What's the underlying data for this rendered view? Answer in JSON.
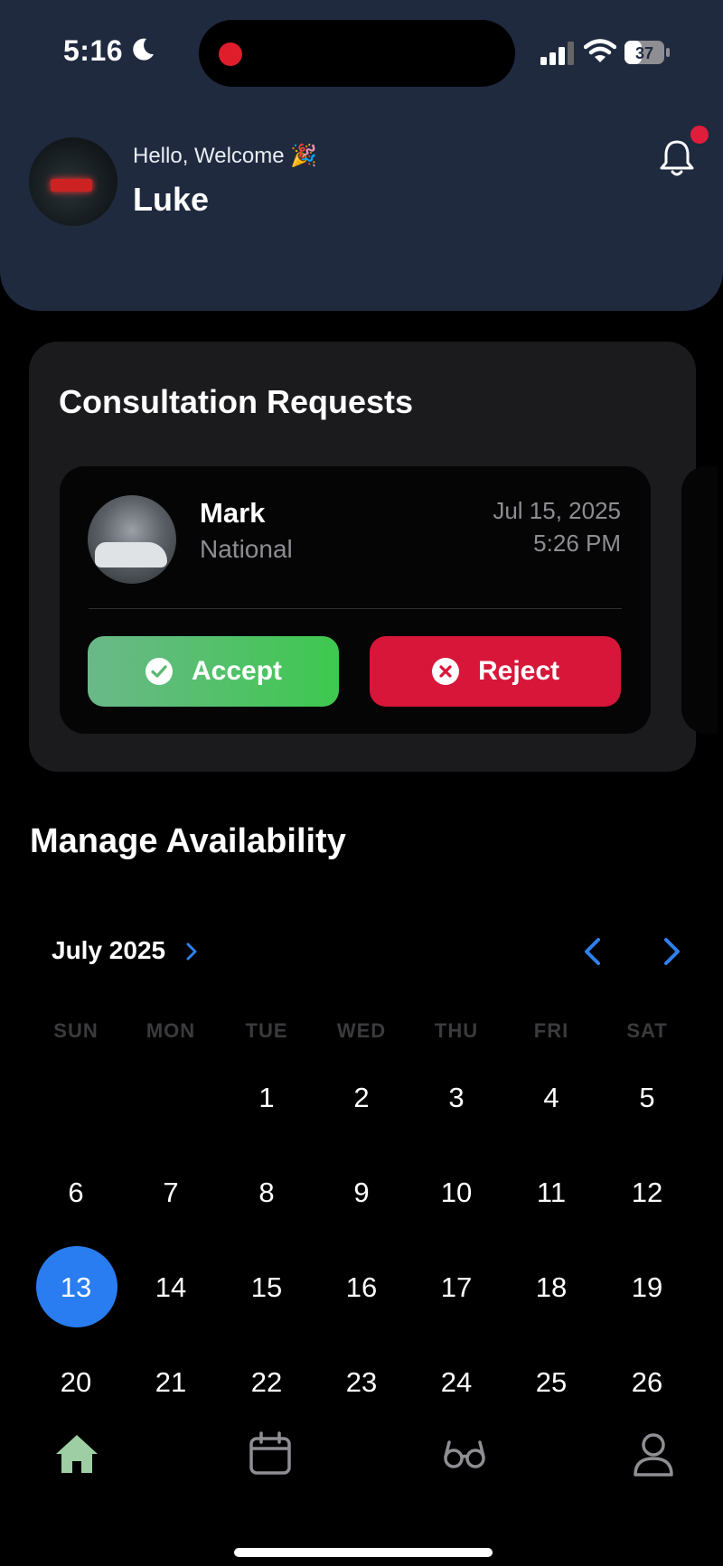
{
  "status_bar": {
    "time": "5:16",
    "battery": "37",
    "icons": [
      "moon-icon",
      "recording-dot",
      "signal-icon",
      "wifi-icon",
      "battery-icon"
    ]
  },
  "header": {
    "greeting": "Hello, Welcome 🎉",
    "user_name": "Luke",
    "notification_icon": "bell-icon",
    "has_unread": true
  },
  "consultation": {
    "title": "Consultation Requests",
    "request": {
      "name": "Mark",
      "subtitle": "National",
      "date": "Jul 15, 2025",
      "time": "5:26 PM",
      "accept_label": "Accept",
      "reject_label": "Reject"
    }
  },
  "availability": {
    "title": "Manage Availability",
    "month_label": "July 2025",
    "weekdays": [
      "SUN",
      "MON",
      "TUE",
      "WED",
      "THU",
      "FRI",
      "SAT"
    ],
    "days": [
      [
        "",
        "",
        "1",
        "2",
        "3",
        "4",
        "5"
      ],
      [
        "6",
        "7",
        "8",
        "9",
        "10",
        "11",
        "12"
      ],
      [
        "13",
        "14",
        "15",
        "16",
        "17",
        "18",
        "19"
      ],
      [
        "20",
        "21",
        "22",
        "23",
        "24",
        "25",
        "26"
      ]
    ],
    "selected_day": "13"
  },
  "tab_bar": {
    "items": [
      {
        "icon": "home-icon",
        "active": true
      },
      {
        "icon": "calendar-icon",
        "active": false
      },
      {
        "icon": "glasses-icon",
        "active": false
      },
      {
        "icon": "profile-icon",
        "active": false
      }
    ]
  },
  "colors": {
    "header_bg": "#1f2a3f",
    "card_bg": "#1b1a1c",
    "accept": "#3ec84f",
    "reject": "#d8163a",
    "selected_day": "#2a7df0",
    "accent_blue": "#2f80ed",
    "active_tab": "#9ecfa4"
  }
}
